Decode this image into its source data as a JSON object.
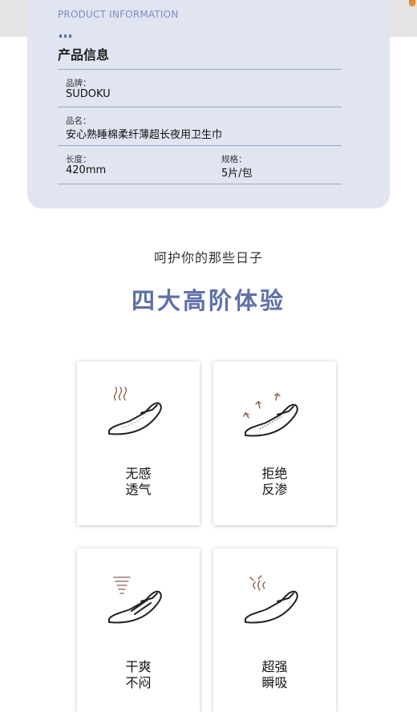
{
  "product": {
    "section_en": "PRODUCT INFORMATION",
    "section_cn": "产品信息",
    "brand_label": "品牌：",
    "brand_value": "SUDOKU",
    "name_label": "品名：",
    "name_value": "安心熟睡棉柔纤薄超长夜用卫生巾",
    "length_label": "长度：",
    "length_value": "420mm",
    "spec_label": "规格：",
    "spec_value": "5片/包"
  },
  "tagline": "呵护你的那些日子",
  "headline": "四大高阶体验",
  "features": [
    {
      "line1": "无感",
      "line2": "透气",
      "icon": "breathable-pad-icon"
    },
    {
      "line1": "拒绝",
      "line2": "反渗",
      "icon": "anti-backflow-pad-icon"
    },
    {
      "line1": "干爽",
      "line2": "不闷",
      "icon": "dry-pad-icon"
    },
    {
      "line1": "超强",
      "line2": "瞬吸",
      "icon": "instant-absorb-pad-icon"
    }
  ],
  "colors": {
    "accent": "#5f6fa7",
    "icon": "#8a5a4a",
    "card_bg": "#e1e5f1"
  }
}
